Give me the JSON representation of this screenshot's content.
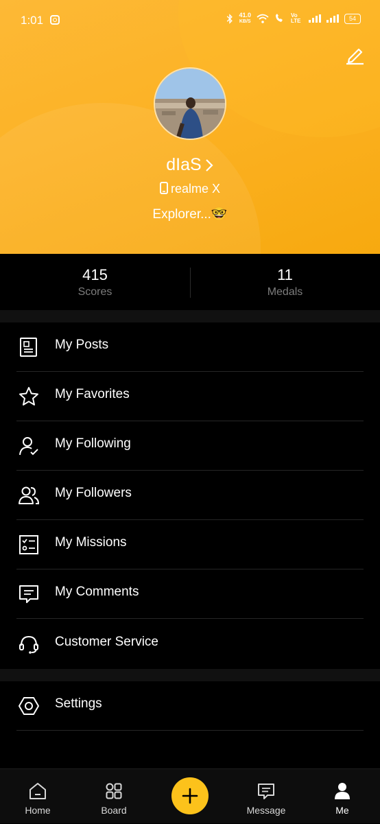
{
  "status_bar": {
    "time": "1:01",
    "speed_value": "41.0",
    "speed_unit": "KB/S",
    "volte": "Vo LTE",
    "battery": "54"
  },
  "profile": {
    "username": "dIaS",
    "device": "realme X",
    "bio": "Explorer...🤓"
  },
  "stats": [
    {
      "value": "415",
      "label": "Scores"
    },
    {
      "value": "11",
      "label": "Medals"
    }
  ],
  "menu": [
    {
      "label": "My Posts",
      "icon": "document-icon"
    },
    {
      "label": "My Favorites",
      "icon": "star-icon"
    },
    {
      "label": "My Following",
      "icon": "user-check-icon"
    },
    {
      "label": "My Followers",
      "icon": "users-icon"
    },
    {
      "label": "My Missions",
      "icon": "checklist-icon"
    },
    {
      "label": "My Comments",
      "icon": "comment-icon"
    },
    {
      "label": "Customer Service",
      "icon": "headset-icon"
    },
    {
      "label": "Settings",
      "icon": "hexagon-settings-icon"
    }
  ],
  "tabs": [
    {
      "label": "Home",
      "icon": "home-icon"
    },
    {
      "label": "Board",
      "icon": "grid-icon"
    },
    {
      "label": "Message",
      "icon": "message-icon"
    },
    {
      "label": "Me",
      "icon": "person-icon"
    }
  ],
  "colors": {
    "header_yellow": "#fcb225",
    "fab_yellow": "#fcc21b",
    "background": "#000000"
  }
}
